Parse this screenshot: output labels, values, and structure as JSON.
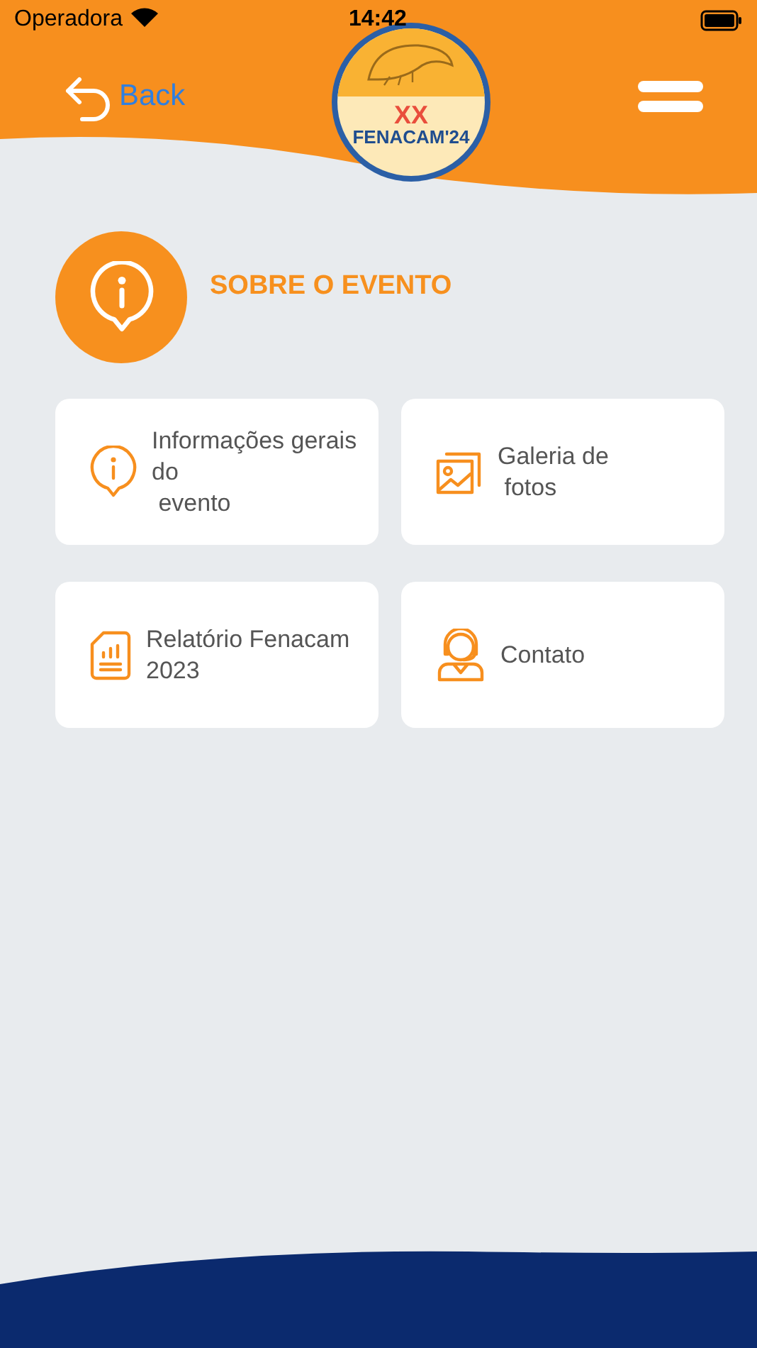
{
  "status_bar": {
    "carrier": "Operadora",
    "time": "14:42"
  },
  "header": {
    "back": "Back",
    "logo": {
      "line_1": "XX",
      "line_2": "FENACAM'24"
    }
  },
  "section": {
    "title": "SOBRE O EVENTO"
  },
  "cards": [
    {
      "kind": "info",
      "lines": [
        "Informações gerais",
        "do",
        " evento"
      ]
    },
    {
      "kind": "gallery",
      "lines": [
        "Galeria de",
        " fotos"
      ]
    },
    {
      "kind": "report",
      "lines": [
        "Relatório Fenacam",
        "2023"
      ]
    },
    {
      "kind": "support",
      "lines": [
        "Contato"
      ]
    }
  ]
}
